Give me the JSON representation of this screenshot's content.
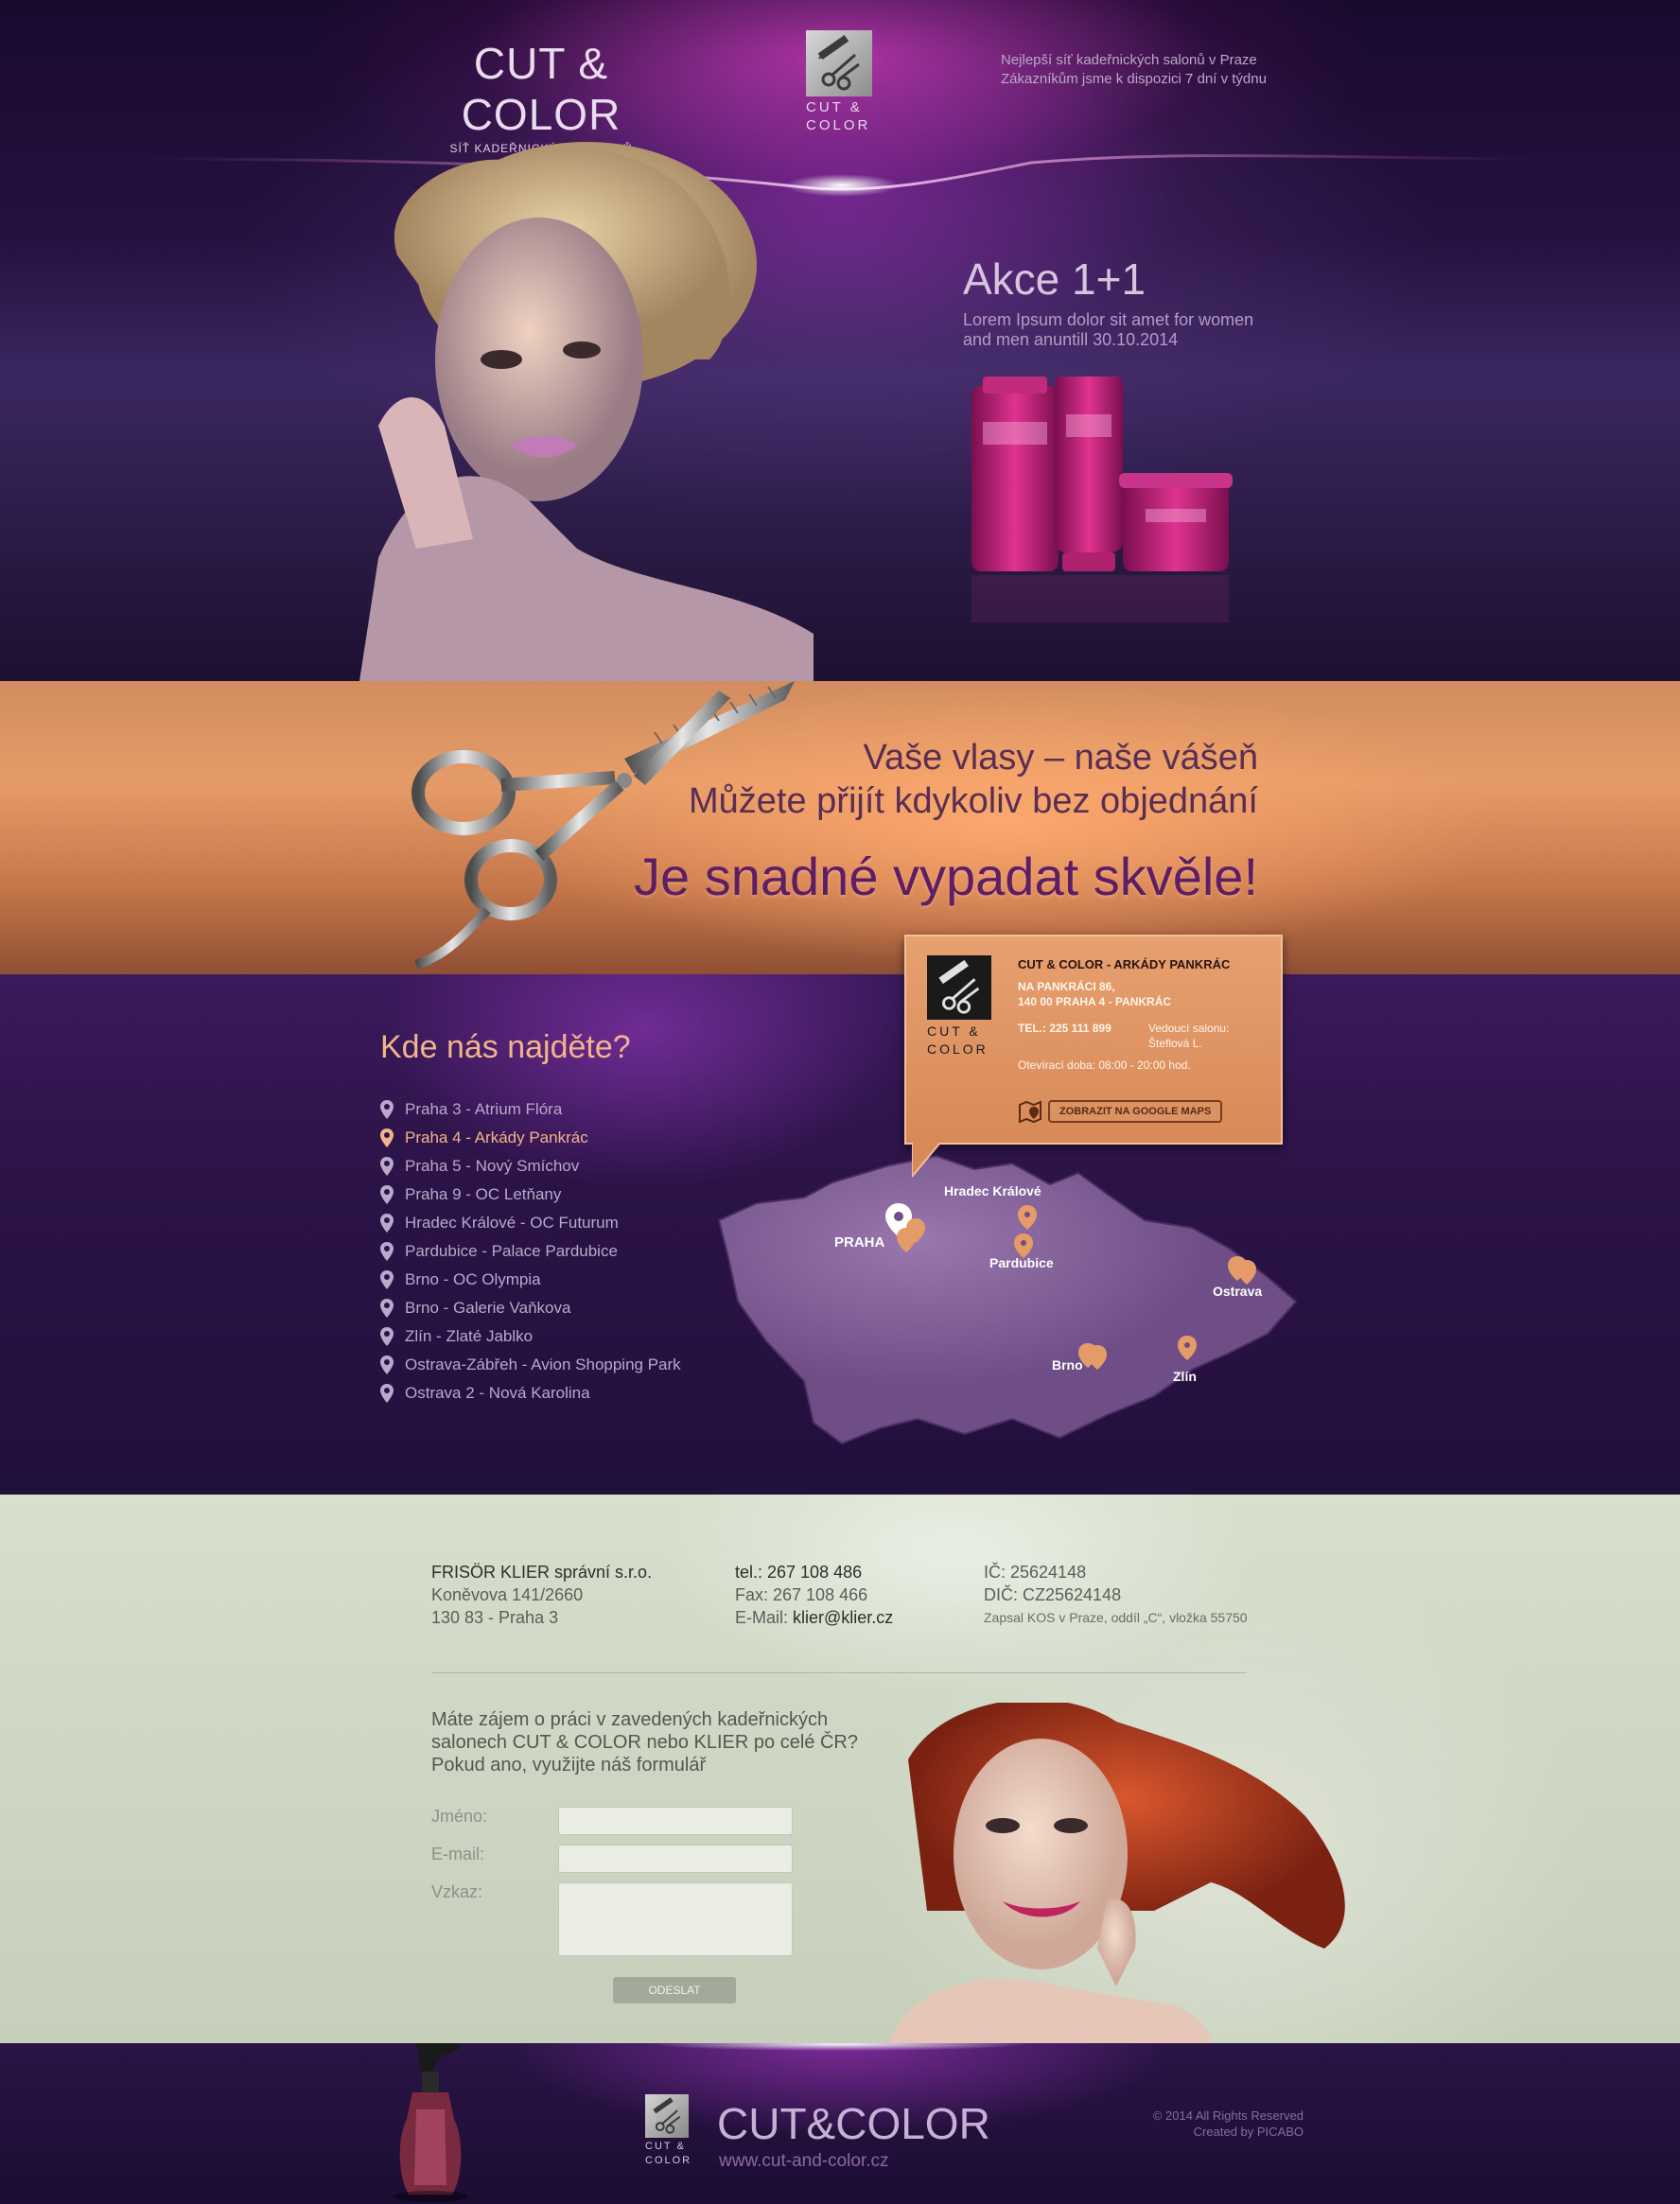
{
  "header": {
    "brand_title": "CUT & COLOR",
    "brand_subtitle": "SÍŤ KADEŘNICKÝCH SALONŮ",
    "logo_text_line1": "CUT &",
    "logo_text_line2": "COLOR",
    "tagline_line1": "Nejlepší síť kadeřnických salonů v Praze",
    "tagline_line2": "Zákazníkům jsme k dispozici 7 dní v týdnu"
  },
  "promo": {
    "title": "Akce 1+1",
    "text_line1": "Lorem Ipsum dolor sit amet for women",
    "text_line2": "and men anuntill 30.10.2014"
  },
  "band": {
    "line1": "Vaše vlasy – naše vášeň",
    "line2": "Můžete přijít kdykoliv bez objednání",
    "slogan": "Je snadné vypadat skvěle!"
  },
  "locations": {
    "title": "Kde nás najděte?",
    "items": [
      {
        "label": "Praha 3 - Atrium Flóra",
        "active": false
      },
      {
        "label": "Praha 4 - Arkády Pankrác",
        "active": true
      },
      {
        "label": "Praha 5 - Nový Smíchov",
        "active": false
      },
      {
        "label": "Praha 9 - OC Letňany",
        "active": false
      },
      {
        "label": "Hradec Králové - OC Futurum",
        "active": false
      },
      {
        "label": "Pardubice - Palace Pardubice",
        "active": false
      },
      {
        "label": "Brno - OC Olympia",
        "active": false
      },
      {
        "label": "Brno - Galerie Vaňkova",
        "active": false
      },
      {
        "label": "Zlín - Zlaté Jablko",
        "active": false
      },
      {
        "label": "Ostrava-Zábřeh - Avion Shopping Park",
        "active": false
      },
      {
        "label": "Ostrava 2 - Nová Karolina",
        "active": false
      }
    ],
    "map_labels": {
      "praha": "PRAHA",
      "hradec": "Hradec Králové",
      "pardubice": "Pardubice",
      "ostrava": "Ostrava",
      "brno": "Brno",
      "zlin": "Zlín"
    },
    "accent_color": "#f2b48a"
  },
  "popup": {
    "name": "CUT & COLOR - ARKÁDY PANKRÁC",
    "address_line1": "NA PANKRÁCI 86,",
    "address_line2": "140 00  PRAHA 4 - PANKRÁC",
    "tel": "TEL.: 225 111 899",
    "manager_label": "Vedoucí salonu:",
    "manager_name": "Šteflová L.",
    "hours": "Otevírací doba: 08:00 - 20:00 hod.",
    "maps_button": "ZOBRAZIT NA GOOGLE MAPS",
    "logo_line1": "CUT &",
    "logo_line2": "COLOR"
  },
  "contact": {
    "company": "FRISÖR KLIER správní s.r.o.",
    "street": "Koněvova 141/2660",
    "city": "130 83 - Praha 3",
    "tel": "tel.: 267 108 486",
    "fax": "Fax: 267 108 466",
    "email_label": "E-Mail: ",
    "email": "klier@klier.cz",
    "ico": "IČ: 25624148",
    "dic": "DIČ: CZ25624148",
    "registry": "Zapsal KOS v Praze, oddíl „C“, vložka 55750"
  },
  "form": {
    "intro_line1": "Máte zájem o práci v zavedených kadeřnických",
    "intro_line2": "salonech CUT & COLOR nebo KLIER po celé ČR?",
    "intro_line3": "Pokud ano, využijte náš formulář",
    "name_label": "Jméno:",
    "email_label": "E-mail:",
    "message_label": "Vzkaz:",
    "submit": "ODESLAT"
  },
  "footer": {
    "brand": "CUT&COLOR",
    "url": "www.cut-and-color.cz",
    "copyright": "© 2014 All Rights Reserved",
    "credit": "Created by PICABO",
    "logo_line1": "CUT &",
    "logo_line2": "COLOR"
  }
}
